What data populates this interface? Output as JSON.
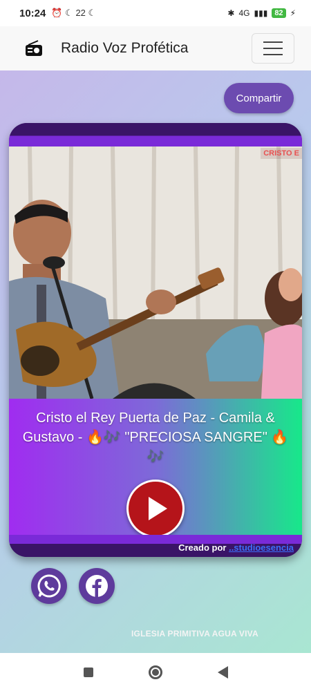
{
  "status_bar": {
    "time": "10:24",
    "left_icons": "⏰ ☾ 22 ☾",
    "network": "4G",
    "battery": "82"
  },
  "app": {
    "title": "Radio Voz Profética",
    "share_label": "Compartir"
  },
  "player": {
    "song_title": "Cristo el Rey Puerta de Paz - Camila & Gustavo - 🔥🎶 \"PRECIOSA SANGRE\" 🔥🎶",
    "cover_tag": "CRISTO E",
    "credit_prefix": "Creado por",
    "credit_link": "..studioesencia"
  },
  "footer": {
    "church_name": "IGLESIA PRIMITIVA AGUA VIVA"
  },
  "colors": {
    "accent": "#6c4bb0",
    "play": "#b5141a",
    "player_frame": "#3a1467"
  }
}
